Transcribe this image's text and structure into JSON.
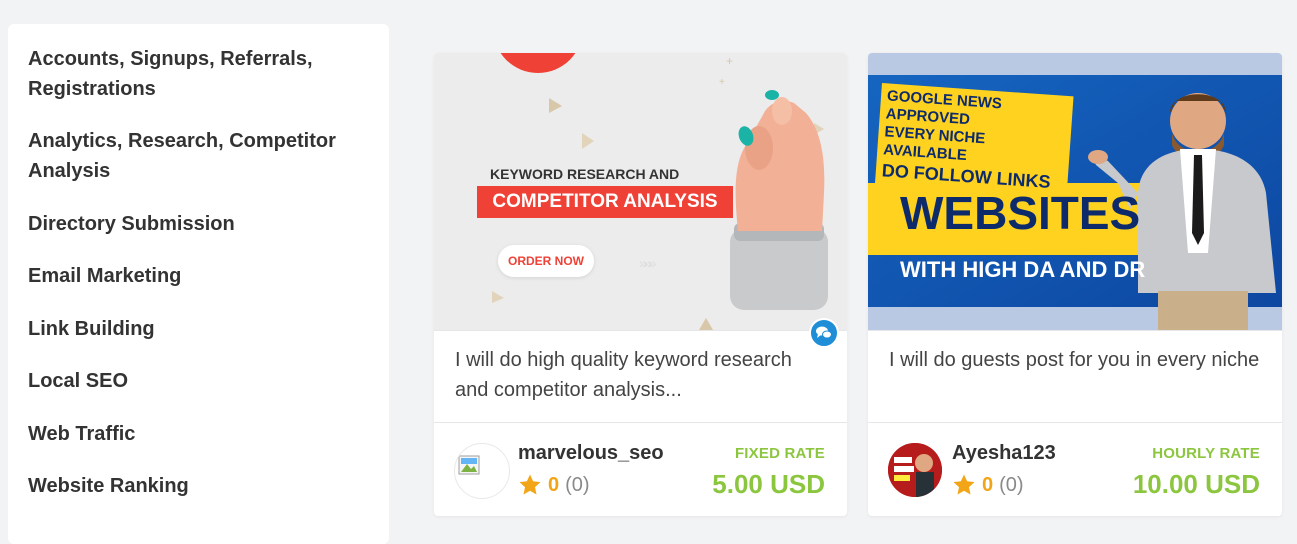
{
  "sidebar": {
    "categories": [
      "Accounts, Signups, Referrals, Registrations",
      "Analytics, Research, Competitor Analysis",
      "Directory Submission",
      "Email Marketing",
      "Link Building",
      "Local SEO",
      "Web Traffic",
      "Website Ranking"
    ]
  },
  "cards": [
    {
      "banner": {
        "line1": "KEYWORD RESEARCH AND",
        "line2": "COMPETITOR ANALYSIS",
        "button": "ORDER NOW"
      },
      "title": "I will do high quality keyword research and competitor analysis...",
      "seller": "marvelous_seo",
      "rating": "0",
      "review_count": "(0)",
      "rate_type": "FIXED RATE",
      "price": "5.00 USD"
    },
    {
      "banner": {
        "line1": "GOOGLE NEWS APPROVED",
        "line2": "EVERY NICHE AVAILABLE",
        "line3": "DO FOLLOW LINKS",
        "headline": "WEBSITES",
        "subline": "WITH HIGH DA AND DR"
      },
      "title": "I will do guests post for you in every niche",
      "seller": "Ayesha123",
      "rating": "0",
      "review_count": "(0)",
      "rate_type": "HOURLY RATE",
      "price": "10.00 USD"
    }
  ],
  "colors": {
    "accent_green": "#8cc63f",
    "star": "#f2a516",
    "chat_badge": "#1f8ed6"
  },
  "icons": [
    "chat-icon",
    "star-icon",
    "broken-image-icon"
  ]
}
